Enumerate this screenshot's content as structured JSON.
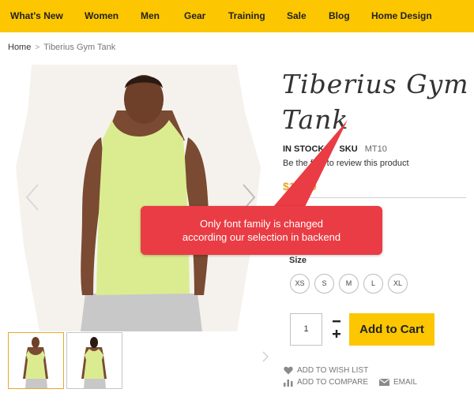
{
  "nav": {
    "items": [
      {
        "label": "What's New"
      },
      {
        "label": "Women"
      },
      {
        "label": "Men"
      },
      {
        "label": "Gear"
      },
      {
        "label": "Training"
      },
      {
        "label": "Sale"
      },
      {
        "label": "Blog"
      },
      {
        "label": "Home Design"
      }
    ]
  },
  "breadcrumb": {
    "home": "Home",
    "separator": ">",
    "current": "Tiberius Gym Tank"
  },
  "product": {
    "title_line1": "Tiberius Gym",
    "title_line2": "Tank",
    "stock": "IN STOCK",
    "sku_label": "SKU",
    "sku_value": "MT10",
    "review_text": "Be the first to review this product",
    "price": "$18.00",
    "size_label": "Size",
    "sizes": [
      "XS",
      "S",
      "M",
      "L",
      "XL"
    ],
    "qty": "1",
    "add_to_cart": "Add to Cart",
    "wishlist": "ADD TO WISH LIST",
    "compare": "ADD TO COMPARE",
    "email": "EMAIL"
  },
  "callout": {
    "line1": "Only font family is changed",
    "line2": "according our selection in backend"
  },
  "colors": {
    "brand_yellow": "#fcc600",
    "price_orange": "#e8a72e",
    "callout_red": "#ea3c44",
    "tank_green": "#dbec90"
  },
  "icons": {
    "wishlist": "heart-icon",
    "compare": "bar-chart-icon",
    "email": "envelope-icon"
  }
}
